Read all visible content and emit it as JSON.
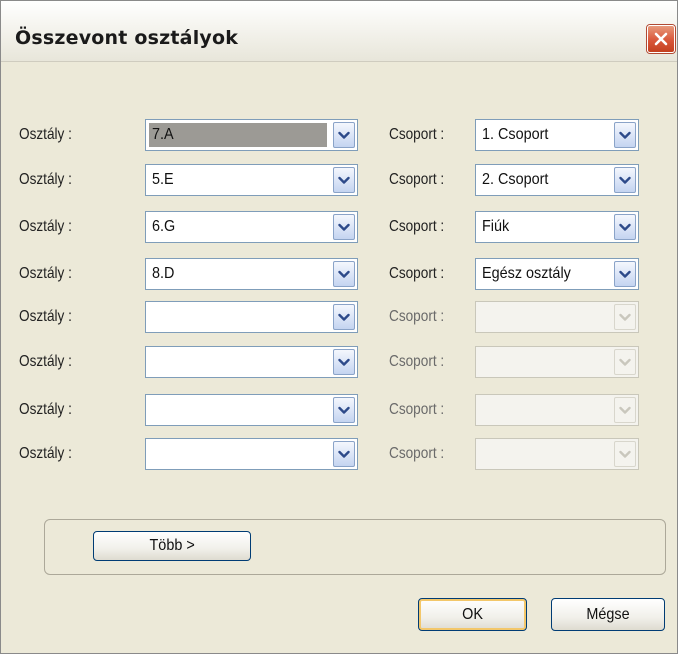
{
  "window": {
    "title": "Összevont osztályok",
    "close_icon": "close-icon"
  },
  "rows": [
    {
      "class_label": "Osztály :",
      "class_value": "7.A",
      "group_label": "Csoport :",
      "group_value": "1. Csoport",
      "selected": true,
      "group_enabled": true
    },
    {
      "class_label": "Osztály :",
      "class_value": "5.E",
      "group_label": "Csoport :",
      "group_value": "2. Csoport",
      "selected": false,
      "group_enabled": true
    },
    {
      "class_label": "Osztály :",
      "class_value": "6.G",
      "group_label": "Csoport :",
      "group_value": "Fiúk",
      "selected": false,
      "group_enabled": true
    },
    {
      "class_label": "Osztály :",
      "class_value": "8.D",
      "group_label": "Csoport :",
      "group_value": "Egész osztály",
      "selected": false,
      "group_enabled": true
    },
    {
      "class_label": "Osztály :",
      "class_value": "",
      "group_label": "Csoport :",
      "group_value": "",
      "selected": false,
      "group_enabled": false
    },
    {
      "class_label": "Osztály :",
      "class_value": "",
      "group_label": "Csoport :",
      "group_value": "",
      "selected": false,
      "group_enabled": false
    },
    {
      "class_label": "Osztály :",
      "class_value": "",
      "group_label": "Csoport :",
      "group_value": "",
      "selected": false,
      "group_enabled": false
    },
    {
      "class_label": "Osztály :",
      "class_value": "",
      "group_label": "Csoport :",
      "group_value": "",
      "selected": false,
      "group_enabled": false
    }
  ],
  "buttons": {
    "more_label": "Több >",
    "ok_label": "OK",
    "cancel_label": "Mégse"
  },
  "colors": {
    "dialog_background": "#ece9d8",
    "close_button": "#d9573a",
    "selection": "#9c9a95",
    "combo_border": "#7f9db9"
  }
}
